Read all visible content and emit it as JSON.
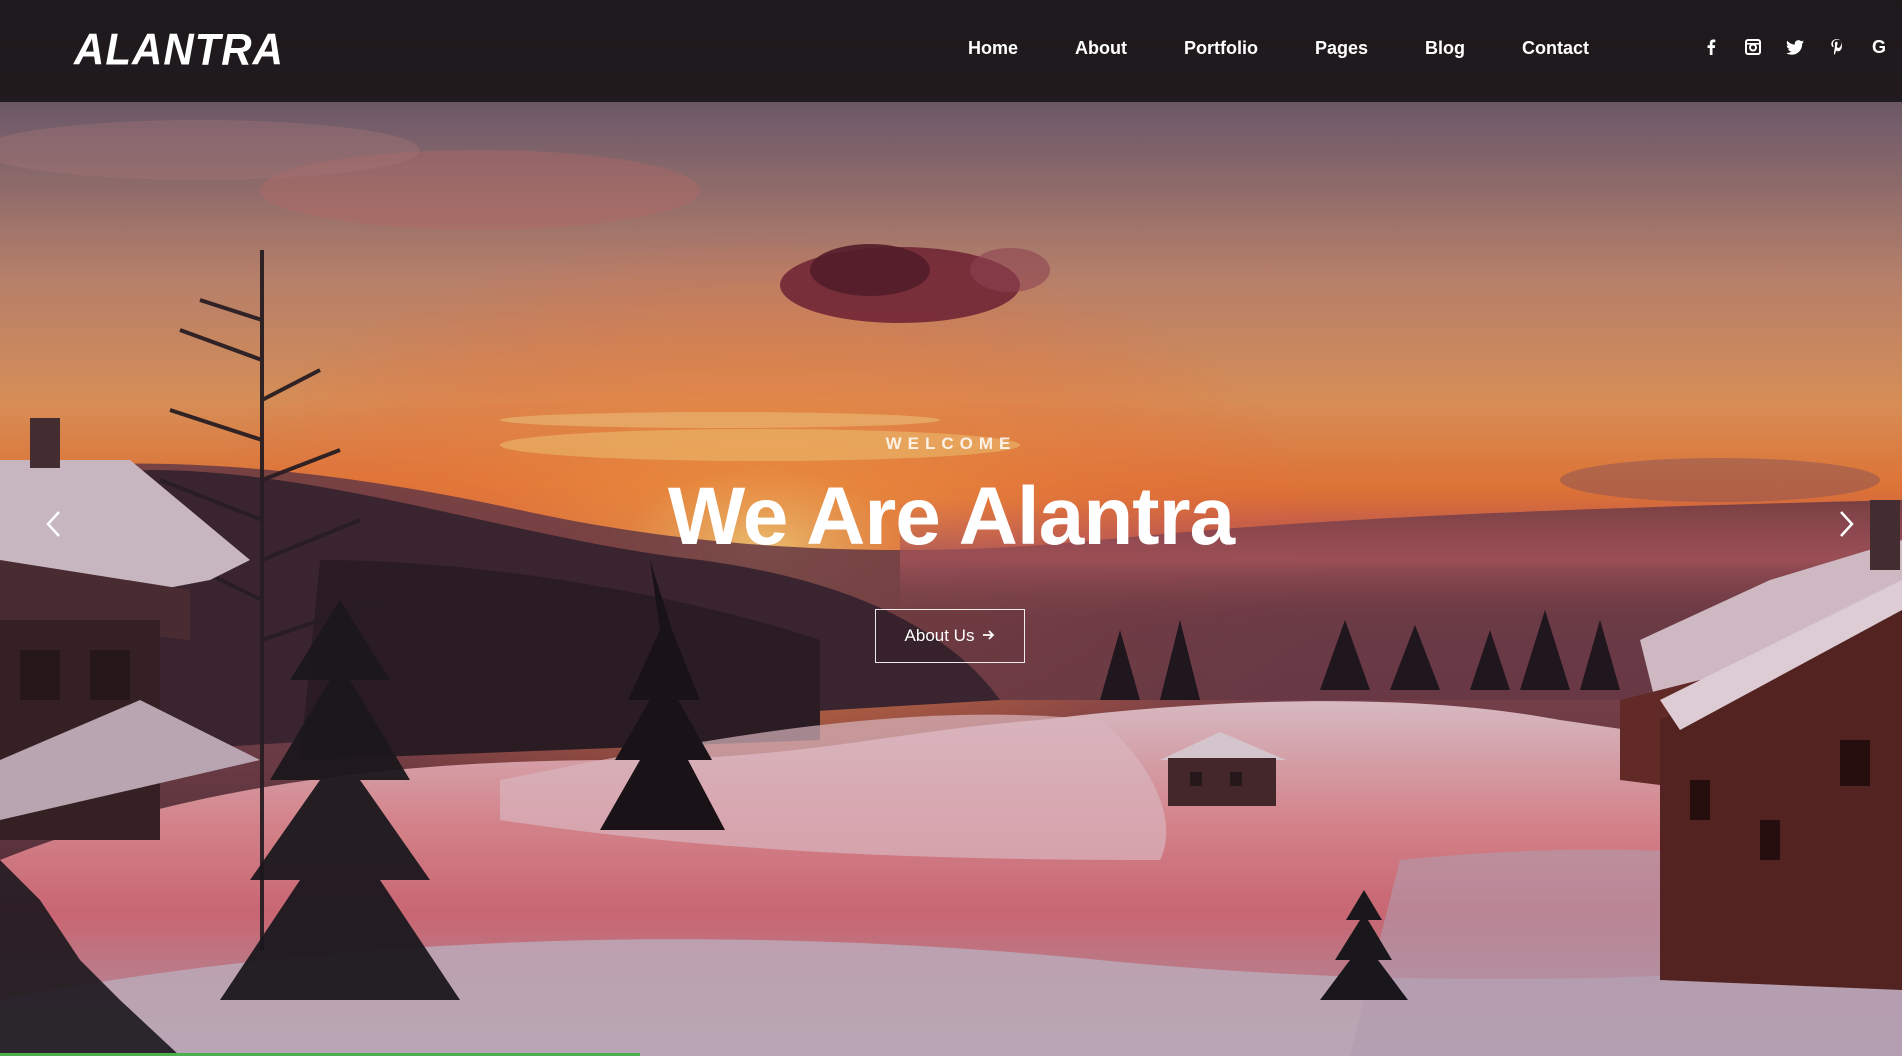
{
  "header": {
    "logo": "ALANTRA",
    "nav": [
      {
        "label": "Home",
        "name": "nav-home"
      },
      {
        "label": "About",
        "name": "nav-about"
      },
      {
        "label": "Portfolio",
        "name": "nav-portfolio"
      },
      {
        "label": "Pages",
        "name": "nav-pages"
      },
      {
        "label": "Blog",
        "name": "nav-blog"
      },
      {
        "label": "Contact",
        "name": "nav-contact"
      }
    ],
    "socials": [
      {
        "icon": "facebook-icon"
      },
      {
        "icon": "instagram-icon"
      },
      {
        "icon": "twitter-icon"
      },
      {
        "icon": "pinterest-icon"
      },
      {
        "icon": "google-plus-icon",
        "glyph": "G"
      }
    ]
  },
  "hero": {
    "kicker": "WELCOME",
    "title": "We Are Alantra",
    "cta_label": "About Us",
    "prev_icon": "chevron-left-icon",
    "next_icon": "chevron-right-icon"
  },
  "colors": {
    "header_bg": "#1a1618",
    "sky_top": "#6b5a66",
    "sky_glow": "#f27a3a",
    "snow_glow": "#e8788a",
    "progress": "#4cae4c"
  }
}
